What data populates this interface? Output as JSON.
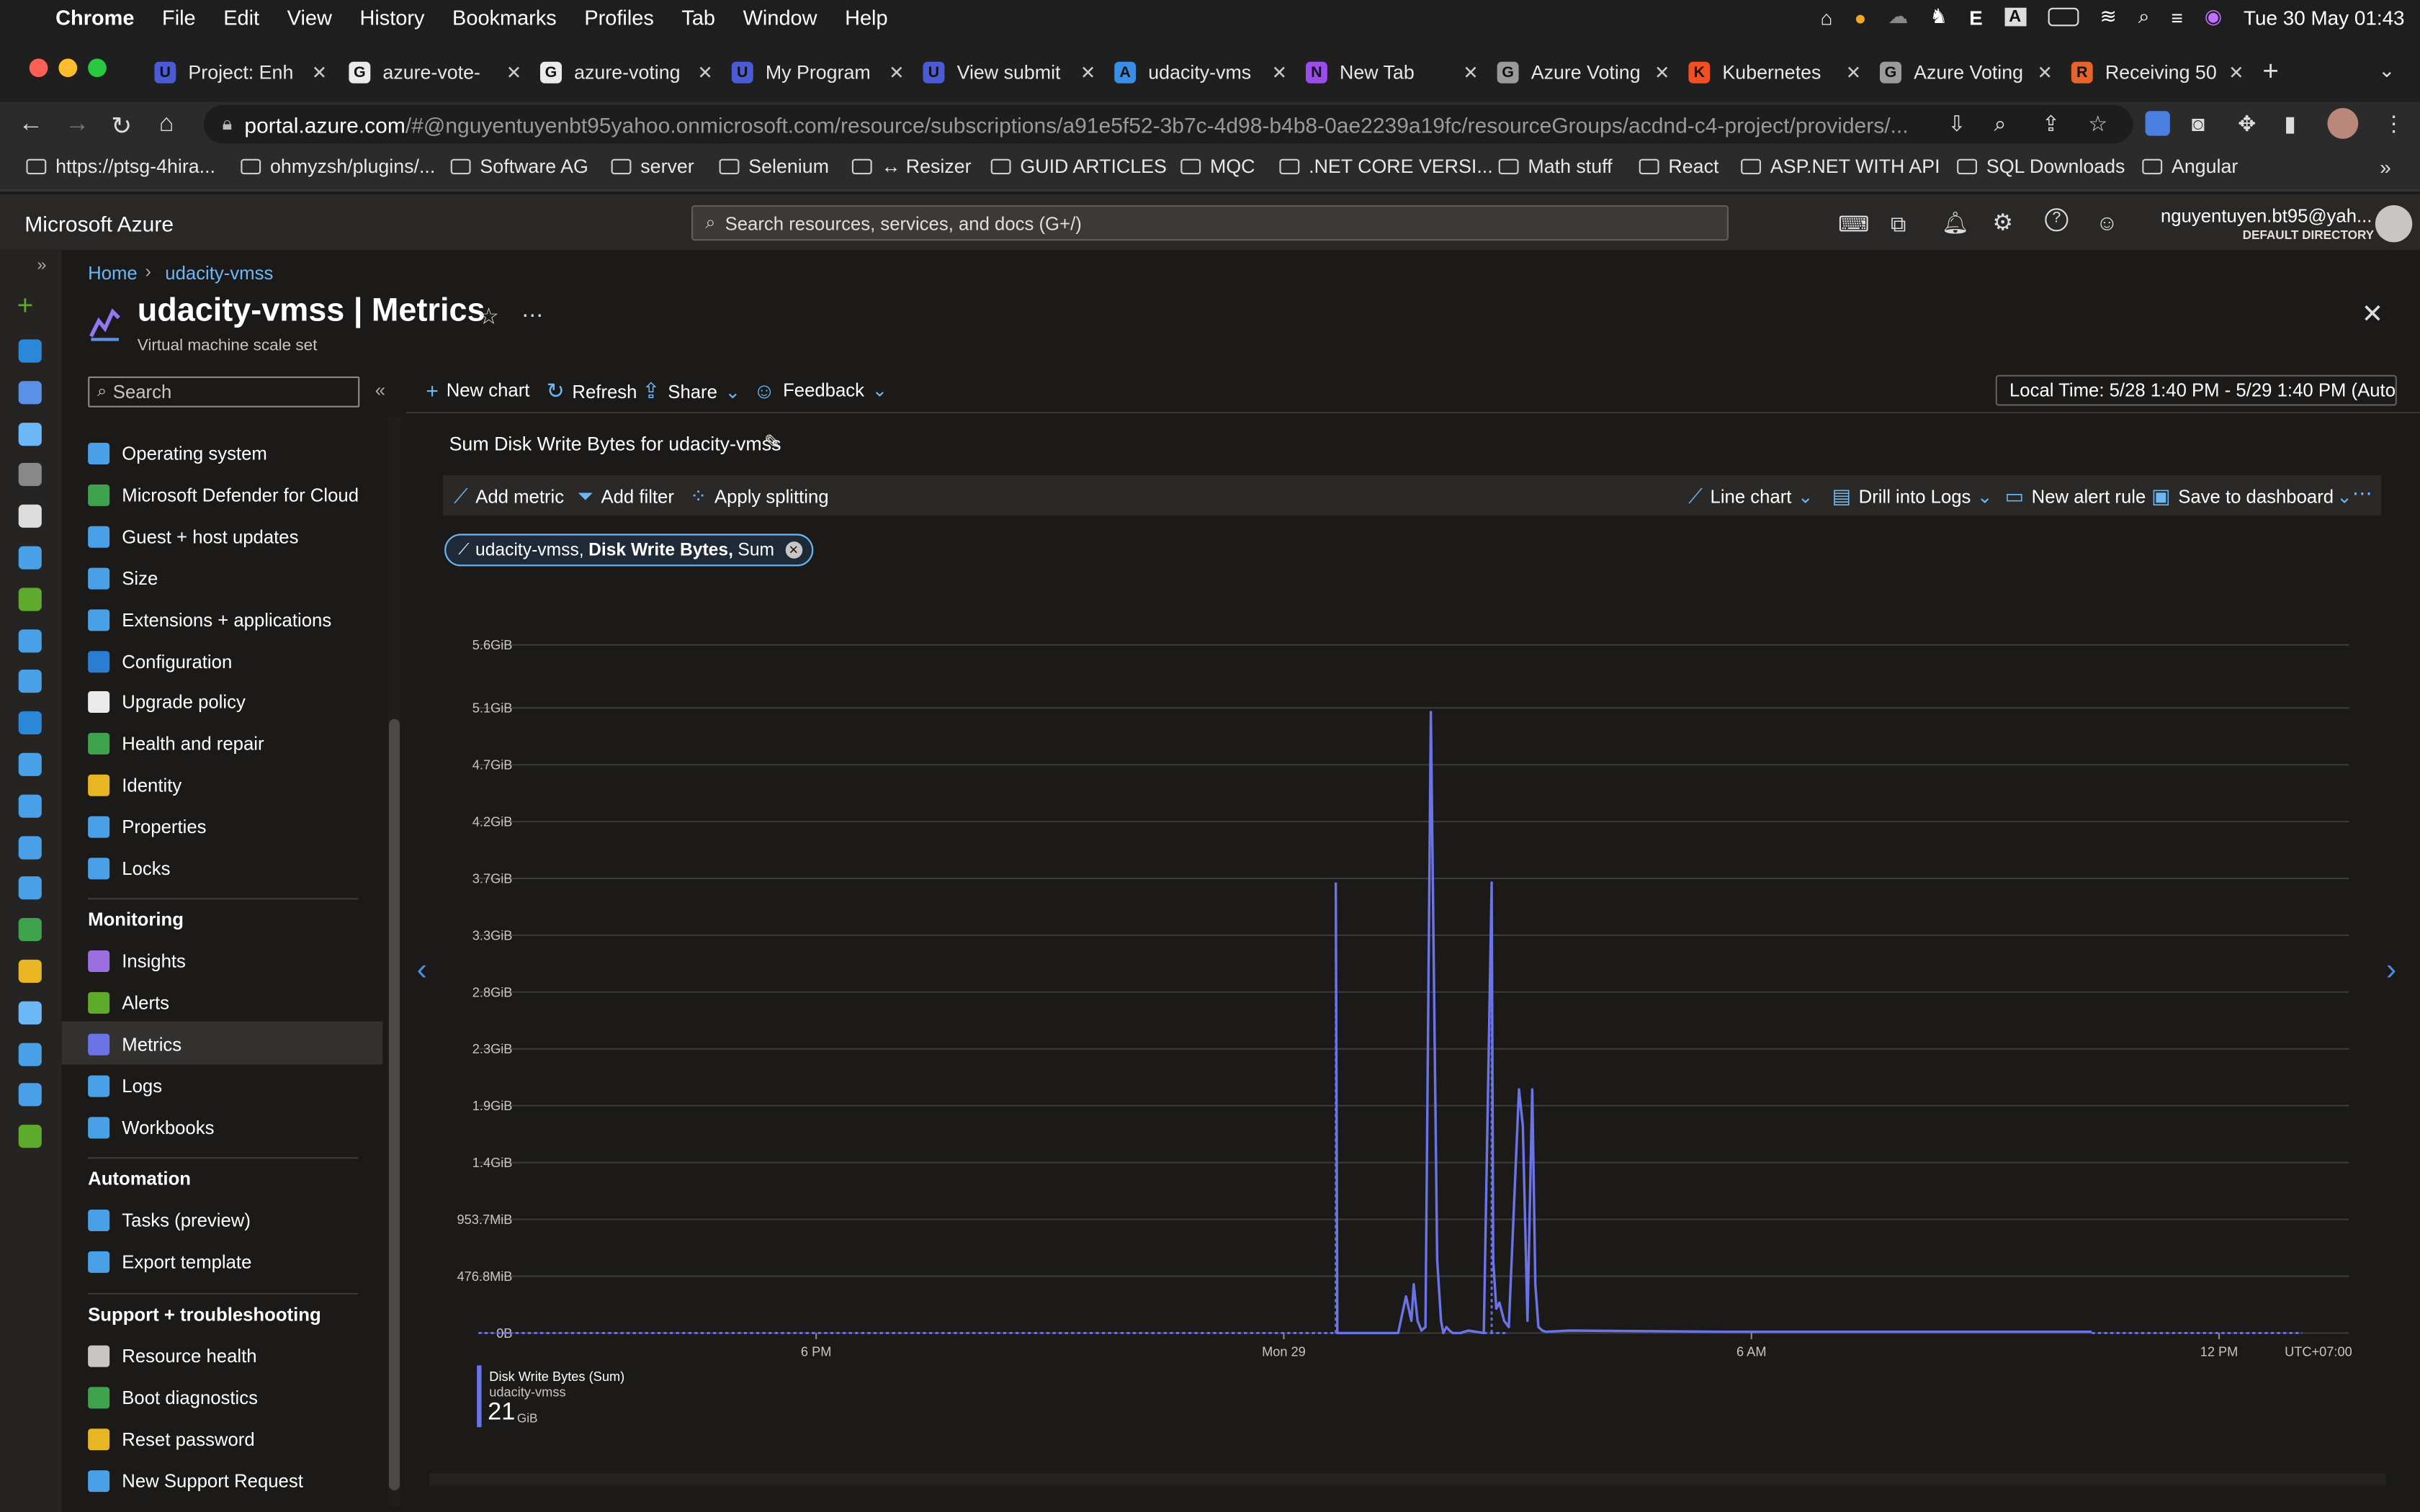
{
  "menubar": {
    "app": "Chrome",
    "items": [
      "File",
      "Edit",
      "View",
      "History",
      "Bookmarks",
      "Profiles",
      "Tab",
      "Window",
      "Help"
    ],
    "clock": "Tue 30 May  01:43"
  },
  "tabs": [
    {
      "label": "Project: Enh",
      "fav": "U",
      "color": "#4b5bd6"
    },
    {
      "label": "azure-vote-",
      "fav": "G",
      "color": "#eaeaea"
    },
    {
      "label": "azure-voting",
      "fav": "G",
      "color": "#eaeaea"
    },
    {
      "label": "My Program",
      "fav": "U",
      "color": "#4b5bd6"
    },
    {
      "label": "View submit",
      "fav": "U",
      "color": "#4b5bd6"
    },
    {
      "label": "udacity-vms",
      "fav": "A",
      "color": "#3a8ee6"
    },
    {
      "label": "New Tab",
      "fav": "N",
      "color": "#9b4dea"
    },
    {
      "label": "Azure Voting",
      "fav": "G",
      "color": "#9a9a9a"
    },
    {
      "label": "Kubernetes",
      "fav": "K",
      "color": "#f25022"
    },
    {
      "label": "Azure Voting",
      "fav": "G",
      "color": "#9a9a9a"
    },
    {
      "label": "Receiving 50",
      "fav": "R",
      "color": "#e8622c"
    }
  ],
  "address": {
    "host": "portal.azure.com",
    "path": "/#@nguyentuyenbt95yahoo.onmicrosoft.com/resource/subscriptions/a91e5f52-3b7c-4d98-b4b8-0ae2239a19fc/resourceGroups/acdnd-c4-project/providers/..."
  },
  "bookmarks": [
    "https://ptsg-4hira...",
    "ohmyzsh/plugins/...",
    "Software AG",
    "server",
    "Selenium",
    "↔ Resizer",
    "GUID ARTICLES",
    "MQC",
    ".NET CORE VERSI...",
    "Math stuff",
    "React",
    "ASP.NET WITH API",
    "SQL Downloads",
    "Angular"
  ],
  "azure": {
    "brand": "Microsoft Azure",
    "search_placeholder": "Search resources, services, and docs (G+/)",
    "user_email": "nguyentuyen.bt95@yah...",
    "user_dir": "DEFAULT DIRECTORY"
  },
  "breadcrumb": {
    "home": "Home",
    "current": "udacity-vmss"
  },
  "blade": {
    "title": "udacity-vmss | Metrics",
    "subtitle": "Virtual machine scale set"
  },
  "menu": {
    "search_placeholder": "Search",
    "items_top": [
      {
        "label": "Operating system",
        "color": "#4aa0e6"
      },
      {
        "label": "Microsoft Defender for Cloud",
        "color": "#3fa34d"
      },
      {
        "label": "Guest + host updates",
        "color": "#4aa0e6"
      },
      {
        "label": "Size",
        "color": "#4aa0e6"
      },
      {
        "label": "Extensions + applications",
        "color": "#4aa0e6"
      },
      {
        "label": "Configuration",
        "color": "#2b7cd3"
      },
      {
        "label": "Upgrade policy",
        "color": "#eaeaea"
      },
      {
        "label": "Health and repair",
        "color": "#3fa34d"
      },
      {
        "label": "Identity",
        "color": "#e8b623"
      },
      {
        "label": "Properties",
        "color": "#4aa0e6"
      },
      {
        "label": "Locks",
        "color": "#4aa0e6"
      }
    ],
    "monitoring_header": "Monitoring",
    "items_monitoring": [
      {
        "label": "Insights",
        "color": "#9b6fe0"
      },
      {
        "label": "Alerts",
        "color": "#5eaa2d"
      },
      {
        "label": "Metrics",
        "color": "#6b74e6"
      },
      {
        "label": "Logs",
        "color": "#4aa0e6"
      },
      {
        "label": "Workbooks",
        "color": "#4aa0e6"
      }
    ],
    "automation_header": "Automation",
    "items_automation": [
      {
        "label": "Tasks (preview)",
        "color": "#4aa0e6"
      },
      {
        "label": "Export template",
        "color": "#4aa0e6"
      }
    ],
    "support_header": "Support + troubleshooting",
    "items_support": [
      {
        "label": "Resource health",
        "color": "#c8c6c4"
      },
      {
        "label": "Boot diagnostics",
        "color": "#3fa34d"
      },
      {
        "label": "Reset password",
        "color": "#e8b623"
      },
      {
        "label": "New Support Request",
        "color": "#4aa0e6"
      }
    ]
  },
  "toolbar": {
    "new_chart": "New chart",
    "refresh": "Refresh",
    "share": "Share",
    "feedback": "Feedback",
    "time_range": "Local Time: 5/28 1:40 PM - 5/29 1:40 PM (Auto..."
  },
  "chart_header": {
    "title": "Sum Disk Write Bytes for udacity-vmss",
    "add_metric": "Add metric",
    "add_filter": "Add filter",
    "apply_splitting": "Apply splitting",
    "line_chart": "Line chart",
    "drill_logs": "Drill into Logs",
    "new_alert": "New alert rule",
    "save_dashboard": "Save to dashboard",
    "pill_resource": "udacity-vmss,",
    "pill_metric": "Disk Write Bytes,",
    "pill_agg": "Sum"
  },
  "legend": {
    "series": "Disk Write Bytes (Sum)",
    "resource": "udacity-vmss",
    "value": "21",
    "unit": "GiB"
  },
  "chart_data": {
    "type": "line",
    "title": "Sum Disk Write Bytes for udacity-vmss",
    "y_unit": "GiB",
    "y_tick_labels": [
      "0B",
      "476.8MiB",
      "953.7MiB",
      "1.4GiB",
      "1.9GiB",
      "2.3GiB",
      "2.8GiB",
      "3.3GiB",
      "3.7GiB",
      "4.2GiB",
      "4.7GiB",
      "5.1GiB",
      "5.6GiB"
    ],
    "ylim": [
      0,
      5.6
    ],
    "x_tick_labels": [
      "6 PM",
      "Mon 29",
      "6 AM",
      "12 PM"
    ],
    "x_tick_hours": [
      4.333,
      10.333,
      16.333,
      22.333
    ],
    "x_range_hours": [
      0,
      24
    ],
    "timezone": "UTC+07:00",
    "x_origin": "5/28 1:40 PM",
    "color": "#6b74e6",
    "dashed_segments": [
      {
        "x": [
          0,
          11.0
        ],
        "y": [
          0,
          0
        ]
      },
      {
        "x": [
          11.0,
          11.17
        ],
        "y": [
          0,
          0
        ]
      },
      {
        "x": [
          12.9,
          13.2
        ],
        "y": [
          0,
          0
        ]
      },
      {
        "x": [
          20.7,
          23.4
        ],
        "y": [
          0,
          0
        ]
      }
    ],
    "series": [
      {
        "name": "Disk Write Bytes (Sum)",
        "x": [
          11.0,
          11.02,
          11.17,
          11.2,
          11.8,
          11.9,
          11.97,
          12.0,
          12.05,
          12.1,
          12.15,
          12.22,
          12.3,
          12.35,
          12.38,
          12.42,
          12.46,
          12.5,
          12.6,
          12.7,
          12.9,
          13.0,
          13.02,
          13.06,
          13.1,
          13.16,
          13.22,
          13.35,
          13.4,
          13.46,
          13.52,
          13.56,
          13.6,
          13.65,
          13.7,
          14.0,
          16.0,
          18.0,
          20.7
        ],
        "y": [
          3.7,
          0,
          0,
          0,
          0,
          0.3,
          0.1,
          0.4,
          0.1,
          0.02,
          0.05,
          5.1,
          0.6,
          0.1,
          0,
          0.05,
          0.02,
          0,
          0,
          0.02,
          0,
          3.7,
          0.6,
          0.2,
          0.25,
          0.1,
          0.05,
          2.0,
          1.7,
          0.1,
          2.0,
          0.4,
          0.05,
          0.02,
          0.01,
          0.02,
          0.01,
          0.01,
          0.01
        ]
      }
    ]
  }
}
